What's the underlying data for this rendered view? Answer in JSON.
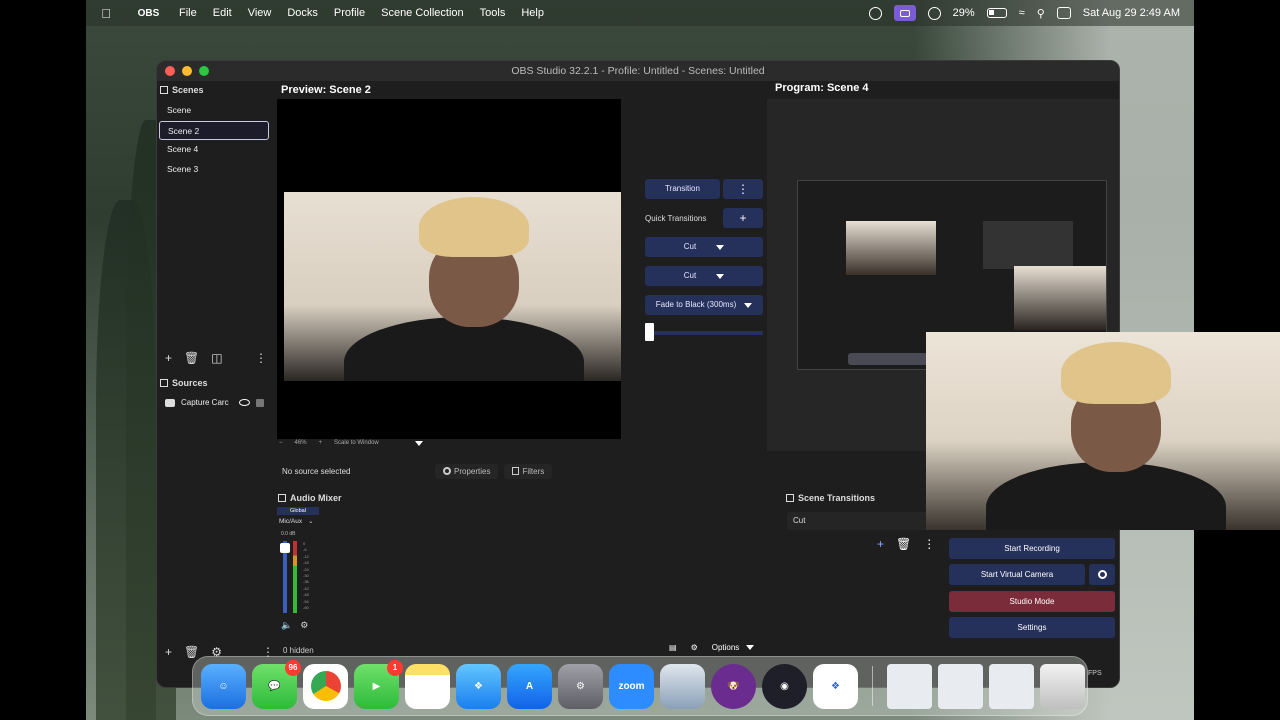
{
  "menubar": {
    "app_name": "OBS",
    "menus": [
      "File",
      "Edit",
      "View",
      "Docks",
      "Profile",
      "Scene Collection",
      "Tools",
      "Help"
    ],
    "battery": "29%",
    "datetime": "Sat Aug 29  2:49 AM"
  },
  "window": {
    "title": "OBS Studio 32.2.1 - Profile: Untitled - Scenes: Untitled"
  },
  "scenes": {
    "title": "Scenes",
    "items": [
      "Scene",
      "Scene 2",
      "Scene 4",
      "Scene 3"
    ],
    "selected": "Scene 2"
  },
  "sources": {
    "title": "Sources",
    "items": [
      "Capture Carc"
    ]
  },
  "preview": {
    "label": "Preview: Scene 2",
    "zoom": "46%",
    "scale_mode": "Scale to Window"
  },
  "program": {
    "label": "Program: Scene 4"
  },
  "transitions_panel": {
    "transition_button": "Transition",
    "quick_label": "Quick Transitions",
    "quick_items": [
      "Cut",
      "Cut",
      "Fade to Black (300ms)"
    ]
  },
  "context_bar": {
    "no_source": "No source selected",
    "properties": "Properties",
    "filters": "Filters"
  },
  "mixer": {
    "title": "Audio Mixer",
    "global": "Global",
    "channel": "Mic/Aux",
    "db": "0.0 dB",
    "ticks": [
      "0",
      "-6",
      "-12",
      "-18",
      "-24",
      "-30",
      "-36",
      "-42",
      "-48",
      "-54",
      "-60"
    ]
  },
  "scene_transitions": {
    "title": "Scene Transitions",
    "selected": "Cut"
  },
  "controls": {
    "start_recording": "Start Recording",
    "start_virtual_camera": "Start Virtual Camera",
    "studio_mode": "Studio Mode",
    "settings": "Settings"
  },
  "status": {
    "hidden": "0 hidden",
    "options": "Options",
    "fps": "FPS"
  },
  "dock": {
    "messages_badge": "96",
    "facetime_badge": "1",
    "zoom_label": "zoom"
  },
  "colors": {
    "accent": "#25305b",
    "studio_mode": "#7a2c3a"
  }
}
